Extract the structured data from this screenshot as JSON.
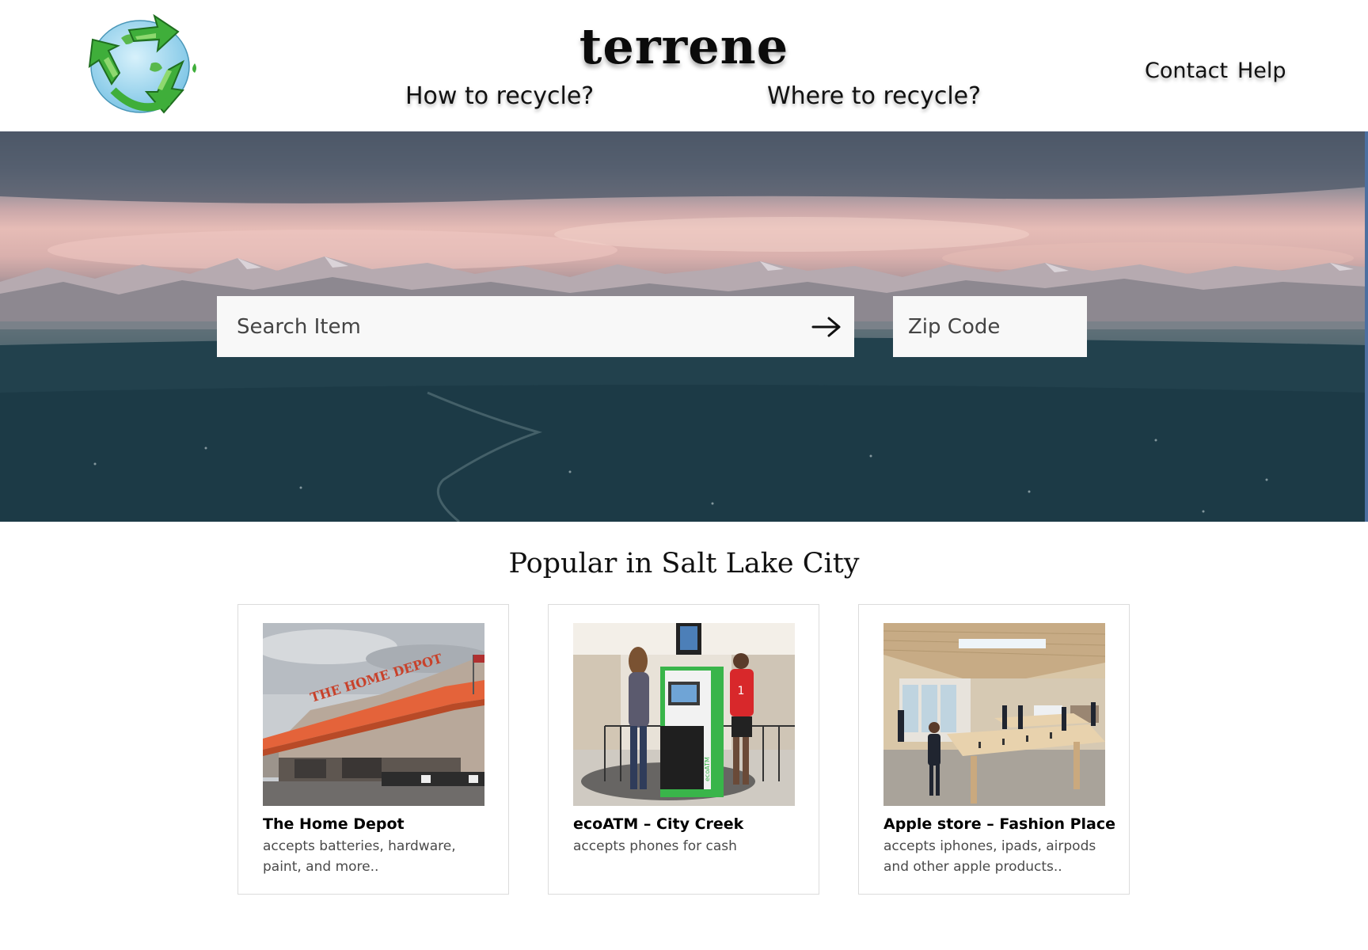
{
  "header": {
    "brand": "terrene",
    "logo_icon": "recycle-globe-icon",
    "nav_primary": [
      "How to recycle?",
      "Where to recycle?"
    ],
    "nav_secondary": [
      "Contact",
      "Help"
    ]
  },
  "hero": {
    "search_placeholder": "Search Item",
    "search_icon": "arrow-right-icon",
    "zip_placeholder": "Zip Code"
  },
  "popular": {
    "title": "Popular in Salt Lake City",
    "cards": [
      {
        "title": "The Home Depot",
        "description": "accepts batteries, hardware, paint, and more..",
        "sign_text": "THE HOME DEPOT"
      },
      {
        "title": "ecoATM – City Creek",
        "description": "accepts phones for cash",
        "sign_text": "ecoATM"
      },
      {
        "title": "Apple store – Fashion Place",
        "description": "accepts iphones, ipads, airpods and other apple products.."
      }
    ]
  },
  "colors": {
    "accent_green": "#3fae3a",
    "sky_pink": "#e6bcb6",
    "valley_teal": "#24434f"
  }
}
